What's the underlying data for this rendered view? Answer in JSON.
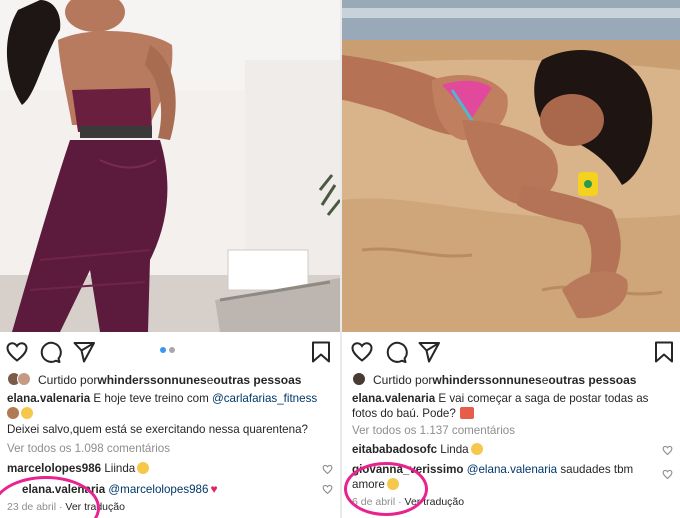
{
  "left_post": {
    "likes": {
      "prefix": "Curtido por ",
      "user": "whinderssonnunes",
      "connector": " e ",
      "others": "outras pessoas"
    },
    "caption": {
      "username": "elana.valenaria",
      "text": " E hoje teve treino com ",
      "mention": "@carlafarias_fitness"
    },
    "caption_line2": "Deixei salvo,quem está se exercitando nessa quarentena?",
    "view_comments": "Ver todos os 1.098 comentários",
    "comments": [
      {
        "username": "marcelolopes986",
        "text": " Liinda"
      },
      {
        "username": "elana.valenaria",
        "mention": "@marcelolopes986"
      }
    ],
    "date": "23 de abril",
    "separator": "·",
    "translate": "Ver tradução"
  },
  "right_post": {
    "likes": {
      "prefix": "Curtido por ",
      "user": "whinderssonnunes",
      "connector": " e ",
      "others": "outras pessoas"
    },
    "caption": {
      "username": "elana.valenaria",
      "text": " E vai começar a saga de postar todas as"
    },
    "caption_line2": "fotos do baú.  Pode?",
    "view_comments": "Ver todos os 1.137 comentários",
    "comments": [
      {
        "username": "eitababadosofc",
        "text": " Linda"
      },
      {
        "username": "giovanna_verissimo",
        "mention": "@elana.valenaria",
        "text": " saudades tbm"
      },
      {
        "text": "amore"
      }
    ],
    "date": "6 de abril",
    "separator": "·",
    "translate": "Ver tradução"
  },
  "icons": [
    "heart-icon",
    "comment-icon",
    "share-icon",
    "bookmark-icon"
  ],
  "colors": {
    "text": "#262626",
    "muted": "#8e8e8e",
    "mention": "#00376b",
    "annotation": "#e8238f",
    "dot_active": "#3897f0"
  }
}
